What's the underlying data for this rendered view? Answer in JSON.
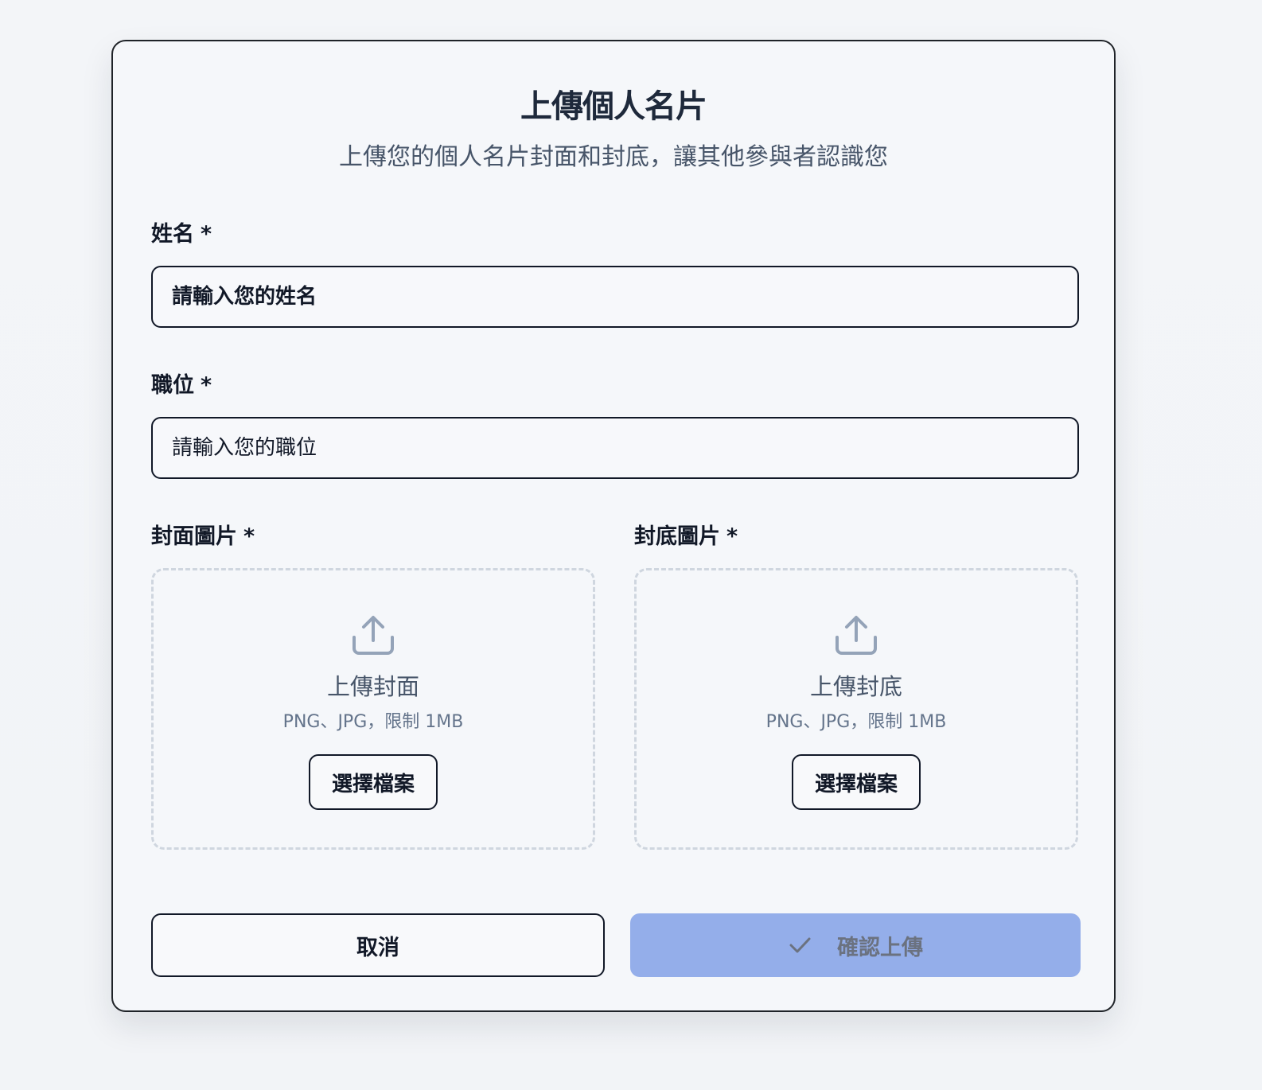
{
  "header": {
    "title": "上傳個人名片",
    "subtitle": "上傳您的個人名片封面和封底，讓其他參與者認識您"
  },
  "fields": {
    "name": {
      "label": "姓名",
      "required_mark": "*",
      "value": "",
      "placeholder": "請輸入您的姓名"
    },
    "position": {
      "label": "職位",
      "required_mark": "*",
      "value": "",
      "placeholder": "請輸入您的職位"
    }
  },
  "uploads": {
    "front": {
      "label": "封面圖片",
      "required_mark": "*",
      "icon": "upload-icon",
      "title": "上傳封面",
      "hint": "PNG、JPG，限制 1MB",
      "button_label": "選擇檔案"
    },
    "back": {
      "label": "封底圖片",
      "required_mark": "*",
      "icon": "upload-icon",
      "title": "上傳封底",
      "hint": "PNG、JPG，限制 1MB",
      "button_label": "選擇檔案"
    }
  },
  "actions": {
    "cancel_label": "取消",
    "confirm_label": "確認上傳",
    "confirm_icon": "check-icon",
    "confirm_disabled": true
  },
  "colors": {
    "page_background": "#f3f5f8",
    "card_border": "#1f2328",
    "title": "#1e293b",
    "muted_text": "#475569",
    "dropzone_border": "#cfd6df",
    "icon": "#94a3b8",
    "confirm_button": "#94aeea",
    "confirm_text": "#6b7280"
  }
}
